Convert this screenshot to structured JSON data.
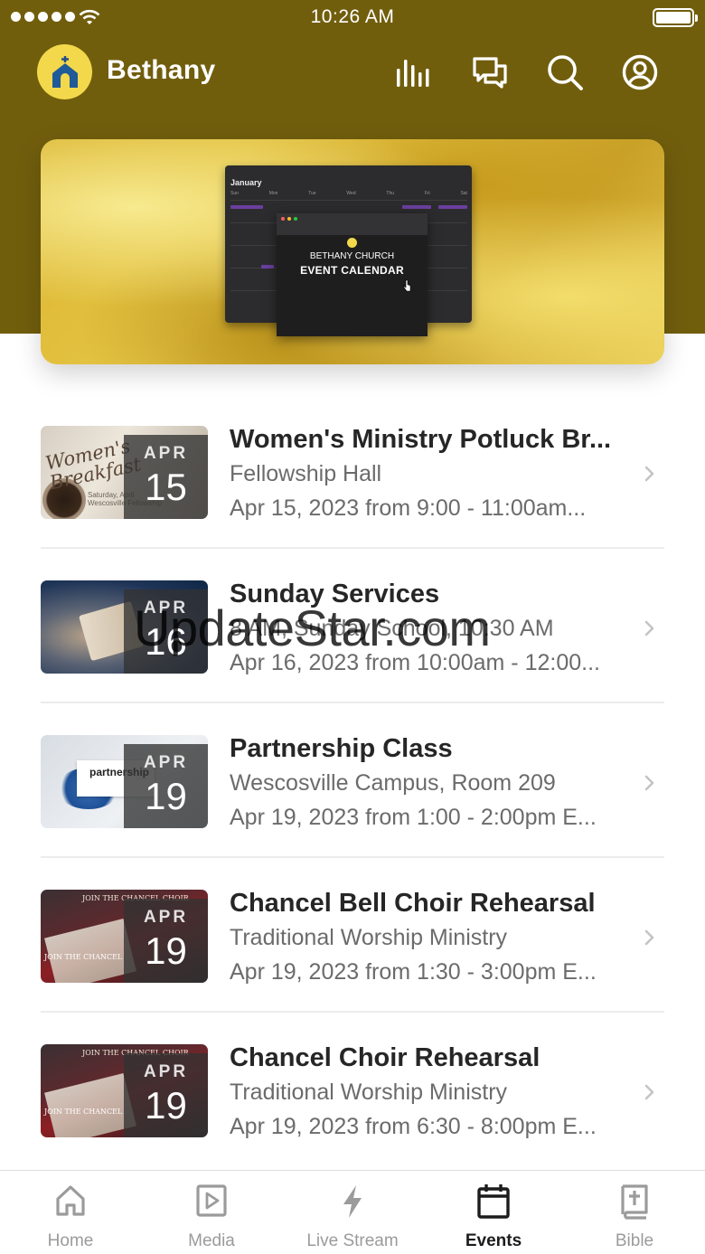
{
  "status_bar": {
    "time": "10:26 AM"
  },
  "header": {
    "app_name": "Bethany"
  },
  "hero": {
    "calendar_month": "January",
    "weekdays": [
      "Sun",
      "Mon",
      "Tue",
      "Wed",
      "Thu",
      "Fri",
      "Sat"
    ],
    "line1": "BETHANY CHURCH",
    "line2": "EVENT CALENDAR"
  },
  "events": [
    {
      "month": "APR",
      "day": "15",
      "title": "Women's Ministry Potluck Br...",
      "subtitle": "Fellowship Hall",
      "time": "Apr 15, 2023 from 9:00 - 11:00am...",
      "thumb_text": "Women's Breakfast"
    },
    {
      "month": "APR",
      "day": "16",
      "title": "Sunday Services",
      "subtitle": "8 AM, Sunday School, 10:30 AM",
      "time": "Apr 16, 2023 from 10:00am - 12:00..."
    },
    {
      "month": "APR",
      "day": "19",
      "title": "Partnership Class",
      "subtitle": "Wescosville Campus, Room 209",
      "time": "Apr 19, 2023 from 1:00 - 2:00pm E...",
      "thumb_text": "partnership"
    },
    {
      "month": "APR",
      "day": "19",
      "title": "Chancel Bell Choir Rehearsal",
      "subtitle": "Traditional Worship Ministry",
      "time": "Apr 19, 2023 from 1:30 - 3:00pm E...",
      "thumb_text": "JOIN THE CHANCEL CHOIR"
    },
    {
      "month": "APR",
      "day": "19",
      "title": "Chancel Choir Rehearsal",
      "subtitle": "Traditional Worship Ministry",
      "time": "Apr 19, 2023 from 6:30 - 8:00pm E...",
      "thumb_text": "JOIN THE CHANCEL CHOIR"
    }
  ],
  "tabs": [
    {
      "label": "Home",
      "icon": "home-icon"
    },
    {
      "label": "Media",
      "icon": "media-icon"
    },
    {
      "label": "Live Stream",
      "icon": "lightning-icon"
    },
    {
      "label": "Events",
      "icon": "calendar-icon",
      "active": true
    },
    {
      "label": "Bible",
      "icon": "bible-icon"
    }
  ],
  "watermark": "UpdateStar.com",
  "colors": {
    "header": "#715e0d",
    "logo_bg": "#f3d84b",
    "text_primary": "#262626",
    "text_secondary": "#6b6b6b",
    "tab_inactive": "#9b9b9b",
    "tab_active": "#1c1c1c"
  }
}
